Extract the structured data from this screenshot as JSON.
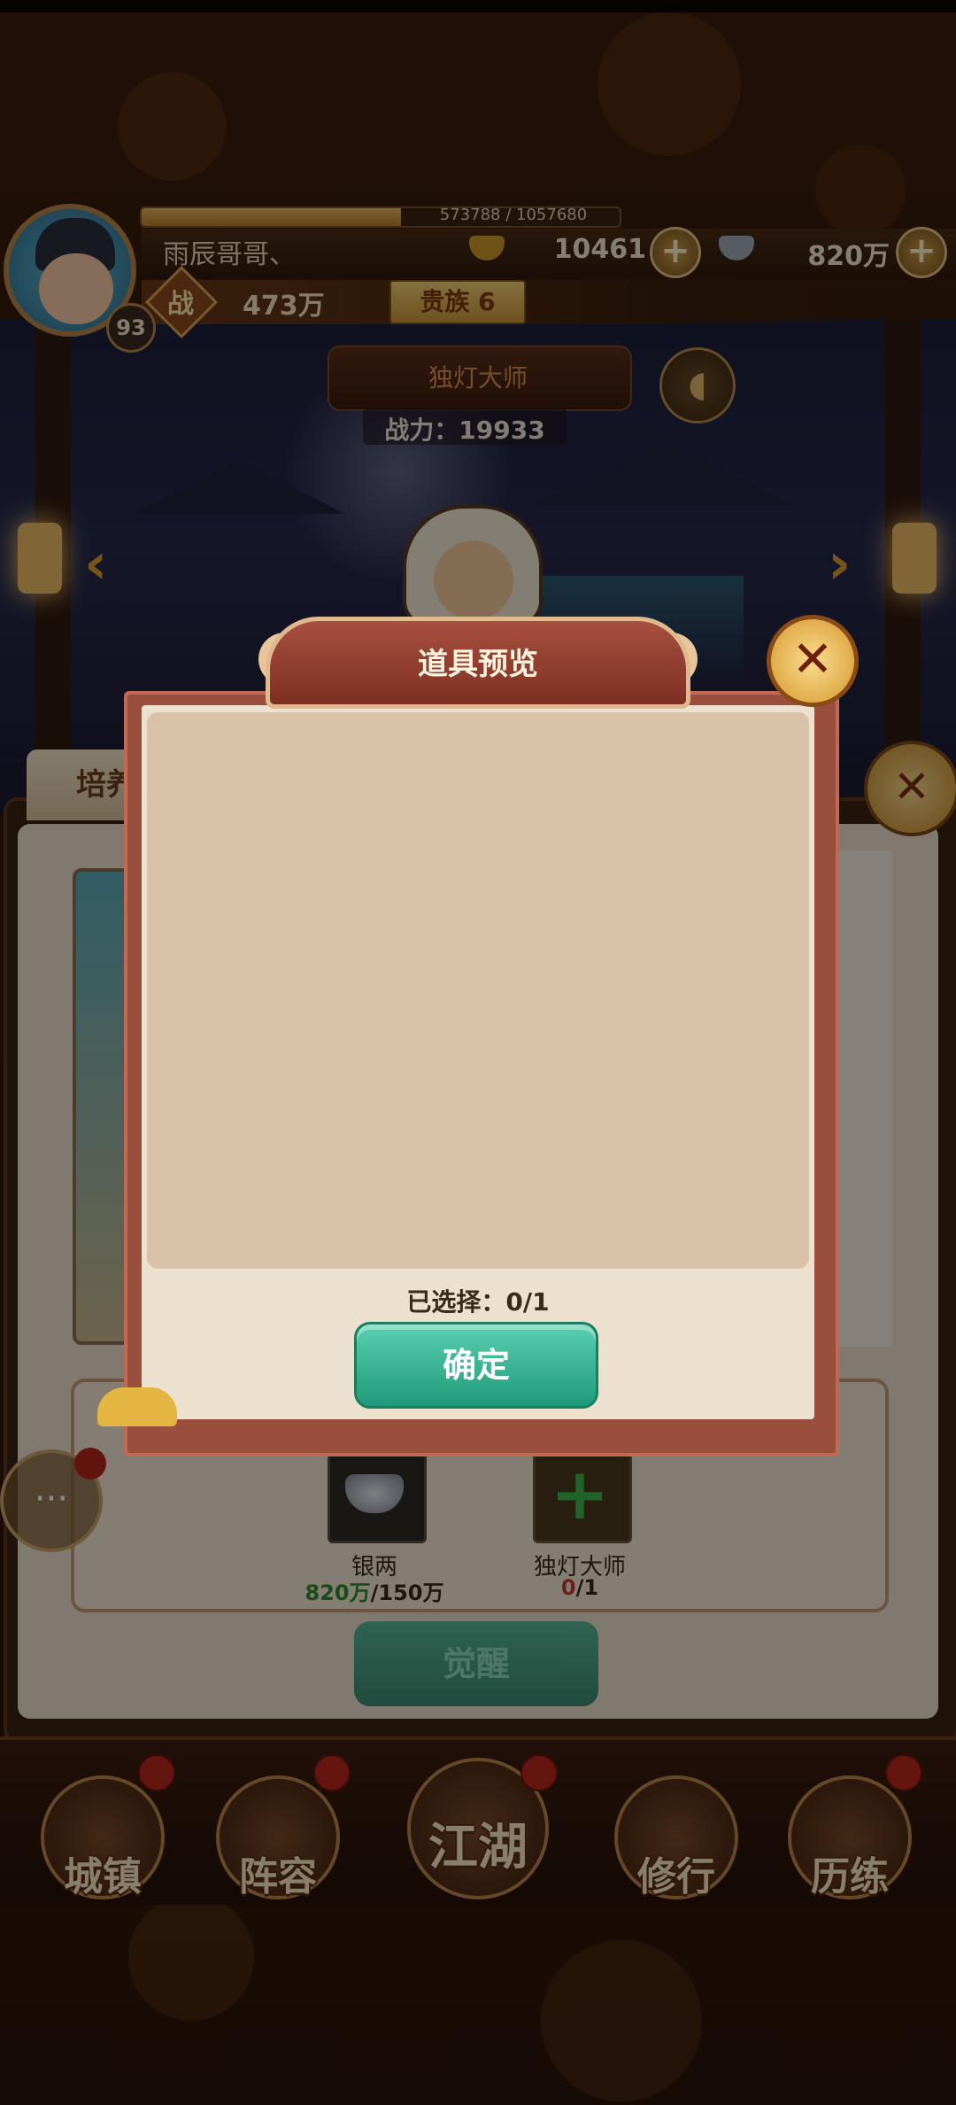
{
  "player": {
    "name": "雨辰哥哥、",
    "level": "93",
    "exp_text": "573788 / 1057680",
    "exp_fraction": 0.5425,
    "power_label": "战",
    "power_value": "473万",
    "vip_label": "贵族 6"
  },
  "currency": {
    "gold_value": "10461",
    "silver_value": "820万",
    "plus": "+"
  },
  "hero": {
    "name": "独灯大师",
    "power_text": "战力：19933",
    "voice_icon": "speaker-icon"
  },
  "panel": {
    "tab_label": "培养",
    "items": [
      {
        "name": "银两",
        "have": "820万",
        "need": "/150万"
      },
      {
        "name": "独灯大师",
        "have": "0",
        "need": "/1"
      }
    ],
    "awaken_button": "觉醒"
  },
  "modal": {
    "title": "道具预览",
    "selected_text": "已选择：0/1",
    "confirm_button": "确定",
    "close_icon": "close-icon"
  },
  "nav": [
    {
      "label": "城镇"
    },
    {
      "label": "阵容"
    },
    {
      "label": "江湖"
    },
    {
      "label": "修行"
    },
    {
      "label": "历练"
    }
  ],
  "colors": {
    "modal_frame": "#9a4e3e",
    "confirm_button": "#1f9a79",
    "notification_dot": "#b8271c"
  }
}
